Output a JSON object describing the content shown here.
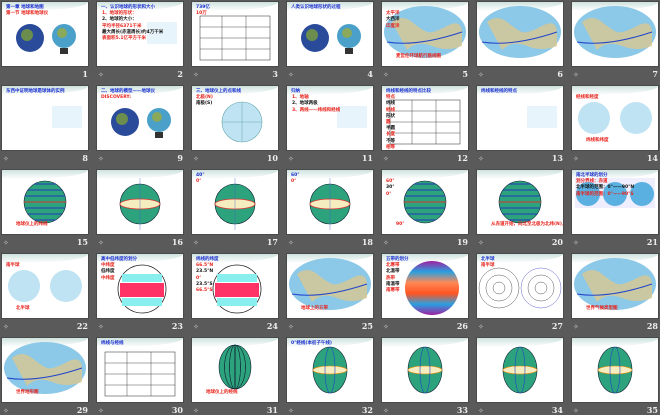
{
  "view": "slide-sorter",
  "colors": {
    "background": "#5a5a5a",
    "globe_green": "#2ca37d",
    "red": "#e8231c",
    "blue": "#1a2fd0"
  },
  "slides": [
    {
      "n": "1",
      "kind": "photo2",
      "texts": [
        "第一章  地球和地图",
        "第一节 地球和地球仪"
      ]
    },
    {
      "n": "2",
      "kind": "text",
      "texts": [
        "一、认识地球的形状和大小",
        "1、地球的形状：",
        "2、地球的大小：",
        "平均半径6371千米",
        "最大周长(赤道周长)约4万千米",
        "表面积5.1亿平方千米"
      ]
    },
    {
      "n": "3",
      "kind": "table",
      "texts": [
        "739亿",
        "10万"
      ]
    },
    {
      "n": "4",
      "kind": "photo2",
      "texts": [
        "人类认识地球形状的过程"
      ]
    },
    {
      "n": "5",
      "kind": "map",
      "texts": [
        "麦哲伦环球航行路线图",
        "太平洋",
        "大西洋",
        "印度洋"
      ]
    },
    {
      "n": "6",
      "kind": "map",
      "texts": []
    },
    {
      "n": "7",
      "kind": "map",
      "texts": []
    },
    {
      "n": "8",
      "kind": "text",
      "texts": [
        "东西中证明地球是球体的实例"
      ]
    },
    {
      "n": "9",
      "kind": "photo2",
      "texts": [
        "二、地球的模型——地球仪",
        "DISCOVERY:"
      ]
    },
    {
      "n": "10",
      "kind": "globe",
      "texts": [
        "三、地球仪上的点和线",
        "北极(N)",
        "南极(S)"
      ]
    },
    {
      "n": "11",
      "kind": "text",
      "texts": [
        "归纳",
        "1、地轴",
        "2、地球两极",
        "3、两线——纬线和经线"
      ]
    },
    {
      "n": "12",
      "kind": "table",
      "texts": [
        "纬线和经线的特点比较",
        "特点",
        "纬线",
        "经线",
        "形状",
        "圆",
        "半圆",
        "长度",
        "不等",
        "相等",
        "指示方向",
        "东西方向",
        "南北方向",
        "相对位置",
        "相互平行",
        "相交于南北两极"
      ]
    },
    {
      "n": "13",
      "kind": "text",
      "texts": [
        "纬线和经线的特点"
      ]
    },
    {
      "n": "14",
      "kind": "globe2",
      "texts": [
        "纬线和纬度",
        "经线和经度"
      ]
    },
    {
      "n": "15",
      "kind": "lat",
      "texts": [
        "地球仪上的纬线"
      ]
    },
    {
      "n": "16",
      "kind": "eq",
      "texts": []
    },
    {
      "n": "17",
      "kind": "eq",
      "texts": [
        "40°",
        "0°"
      ]
    },
    {
      "n": "18",
      "kind": "eq",
      "texts": [
        "60°",
        "0°"
      ]
    },
    {
      "n": "19",
      "kind": "lat",
      "texts": [
        "90°",
        "60°",
        "30°",
        "0°"
      ]
    },
    {
      "n": "20",
      "kind": "lat",
      "texts": [
        "从赤道开始，向北至北极为北纬(N)，向南至南极为南纬(S)"
      ]
    },
    {
      "n": "21",
      "kind": "globe3",
      "texts": [
        "南北半球的划分",
        "划分界线：赤道",
        "北半球的范围：0°——90°N",
        "南半球的范围：0°——90°S"
      ]
    },
    {
      "n": "22",
      "kind": "globe2",
      "texts": [
        "北半球",
        "南半球"
      ]
    },
    {
      "n": "23",
      "kind": "zones",
      "texts": [
        "高中低纬度的划分",
        "中纬度",
        "低纬度",
        "中纬度"
      ]
    },
    {
      "n": "24",
      "kind": "zones",
      "texts": [
        "纬线的纬度",
        "66.5°N",
        "23.5°N",
        "0°",
        "23.5°S",
        "66.5°S"
      ]
    },
    {
      "n": "25",
      "kind": "map",
      "texts": [
        "地球上的五带"
      ]
    },
    {
      "n": "26",
      "kind": "five",
      "texts": [
        "五带的划分",
        "北寒带",
        "北温带",
        "热带",
        "南温带",
        "南寒带"
      ]
    },
    {
      "n": "27",
      "kind": "rings",
      "texts": [
        "北半球",
        "南半球"
      ]
    },
    {
      "n": "28",
      "kind": "map",
      "texts": [
        "世界气候类型图"
      ]
    },
    {
      "n": "29",
      "kind": "map",
      "texts": [
        "世界地形图"
      ]
    },
    {
      "n": "30",
      "kind": "table",
      "texts": [
        "纬线与经线"
      ]
    },
    {
      "n": "31",
      "kind": "lon",
      "texts": [
        "地球仪上的经线"
      ]
    },
    {
      "n": "32",
      "kind": "lon2",
      "texts": [
        "0°经线(本初子午线)"
      ]
    },
    {
      "n": "33",
      "kind": "lon2",
      "texts": []
    },
    {
      "n": "34",
      "kind": "lon2",
      "texts": []
    },
    {
      "n": "35",
      "kind": "lon2",
      "texts": []
    }
  ]
}
